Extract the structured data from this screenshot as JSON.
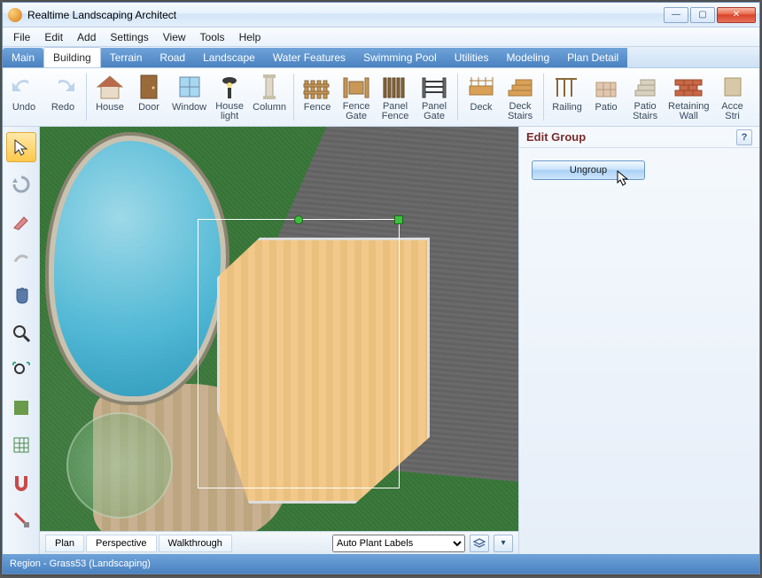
{
  "window": {
    "title": "Realtime Landscaping Architect"
  },
  "menu": {
    "file": "File",
    "edit": "Edit",
    "add": "Add",
    "settings": "Settings",
    "view": "View",
    "tools": "Tools",
    "help": "Help"
  },
  "tabs": {
    "main": "Main",
    "building": "Building",
    "terrain": "Terrain",
    "road": "Road",
    "landscape": "Landscape",
    "water": "Water Features",
    "pool": "Swimming Pool",
    "utilities": "Utilities",
    "modeling": "Modeling",
    "plan": "Plan Detail"
  },
  "ribbon": {
    "undo": "Undo",
    "redo": "Redo",
    "house": "House",
    "door": "Door",
    "window": "Window",
    "house_light": "House\nlight",
    "column": "Column",
    "fence": "Fence",
    "fence_gate": "Fence\nGate",
    "panel_fence": "Panel\nFence",
    "panel_gate": "Panel\nGate",
    "deck": "Deck",
    "deck_stairs": "Deck\nStairs",
    "railing": "Railing",
    "patio": "Patio",
    "patio_stairs": "Patio\nStairs",
    "retaining_wall": "Retaining\nWall",
    "accent": "Acce\nStri"
  },
  "left_tools": {
    "select": "select-tool",
    "orbit": "orbit-tool",
    "move": "move-tool",
    "rotate": "rotate-tool",
    "pan": "pan-tool",
    "zoom": "zoom-tool",
    "zoom_extents": "zoom-extents-tool",
    "style1": "fill-tool",
    "style2": "grid-tool",
    "magnet": "snap-tool",
    "dimension": "dimension-tool"
  },
  "viewtabs": {
    "plan": "Plan",
    "perspective": "Perspective",
    "walkthrough": "Walkthrough",
    "dropdown": "Auto Plant Labels"
  },
  "panel": {
    "title": "Edit Group",
    "ungroup": "Ungroup",
    "help": "?"
  },
  "status": {
    "text": "Region - Grass53 (Landscaping)"
  }
}
